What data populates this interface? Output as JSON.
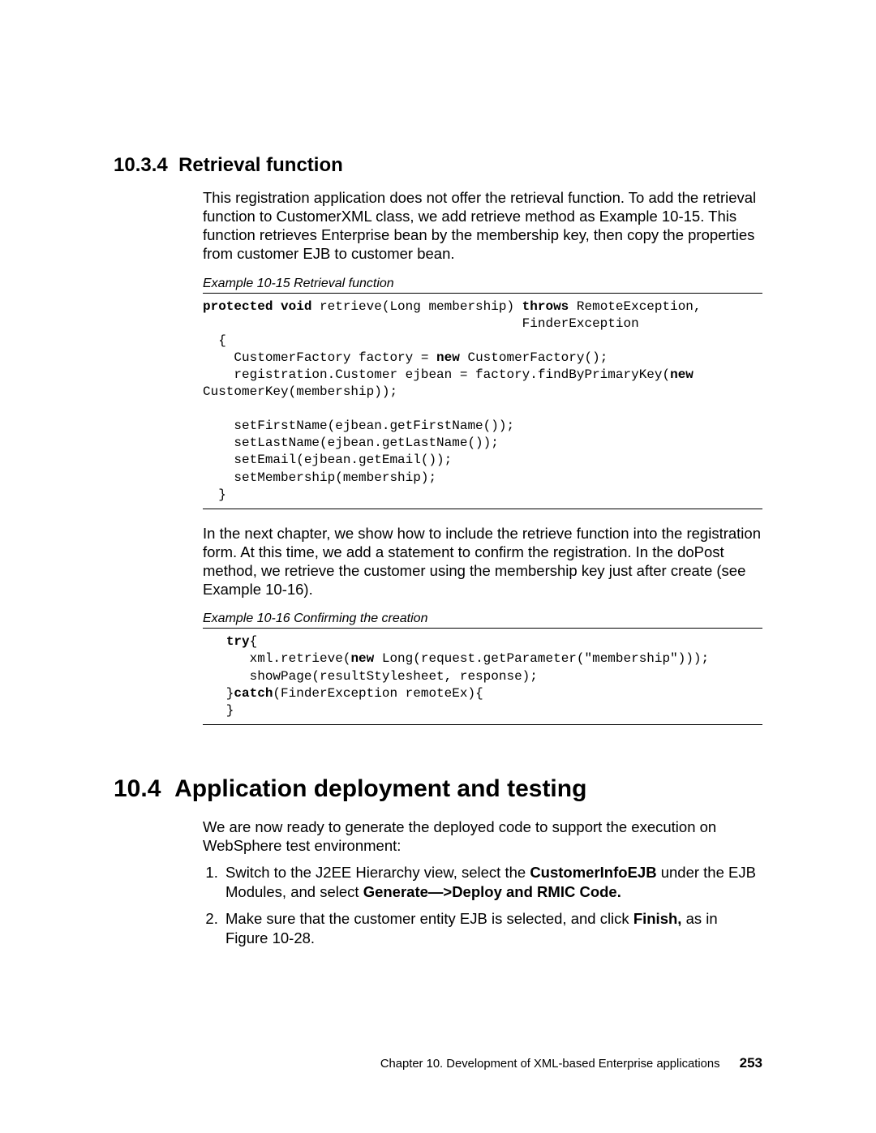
{
  "section1": {
    "number": "10.3.4",
    "title": "Retrieval function",
    "para": "This registration application does not offer the retrieval function. To add the retrieval function to CustomerXML class, we add retrieve method as Example 10-15. This function retrieves Enterprise bean by the membership key, then copy the properties from customer EJB to customer bean."
  },
  "ex15": {
    "caption": "Example 10-15   Retrieval function",
    "code_html": "<b>protected void</b> retrieve(Long membership) <b>throws</b> RemoteException,\n                                         FinderException\n  {\n    CustomerFactory factory = <b>new</b> CustomerFactory();\n    registration.Customer ejbean = factory.findByPrimaryKey(<b>new</b>\nCustomerKey(membership));\n\n    setFirstName(ejbean.getFirstName());\n    setLastName(ejbean.getLastName());\n    setEmail(ejbean.getEmail());\n    setMembership(membership);\n  }"
  },
  "para_after15": "In the next chapter, we show how to include the retrieve function into the registration form. At this time, we add a statement to confirm the registration. In the doPost method, we retrieve the customer using the membership key just after create (see Example 10-16).",
  "ex16": {
    "caption": "Example 10-16   Confirming the creation",
    "code_html": "   <b>try</b>{\n      xml.retrieve(<b>new</b> Long(request.getParameter(\"membership\")));\n      showPage(resultStylesheet, response);\n   }<b>catch</b>(FinderException remoteEx){\n   }"
  },
  "section2": {
    "number": "10.4",
    "title": "Application deployment and testing",
    "para": "We are now ready to generate the deployed code to support the execution on WebSphere test environment:",
    "step1_html": "Switch to the J2EE Hierarchy view, select the <b>CustomerInfoEJB</b> under the EJB Modules, and select <b>Generate—&gt;Deploy and RMIC Code.</b>",
    "step2_html": "Make sure that the customer entity EJB is selected, and click <b>Finish,</b> as in Figure 10-28."
  },
  "footer": {
    "chapter": "Chapter 10. Development of XML-based Enterprise applications",
    "page": "253"
  }
}
